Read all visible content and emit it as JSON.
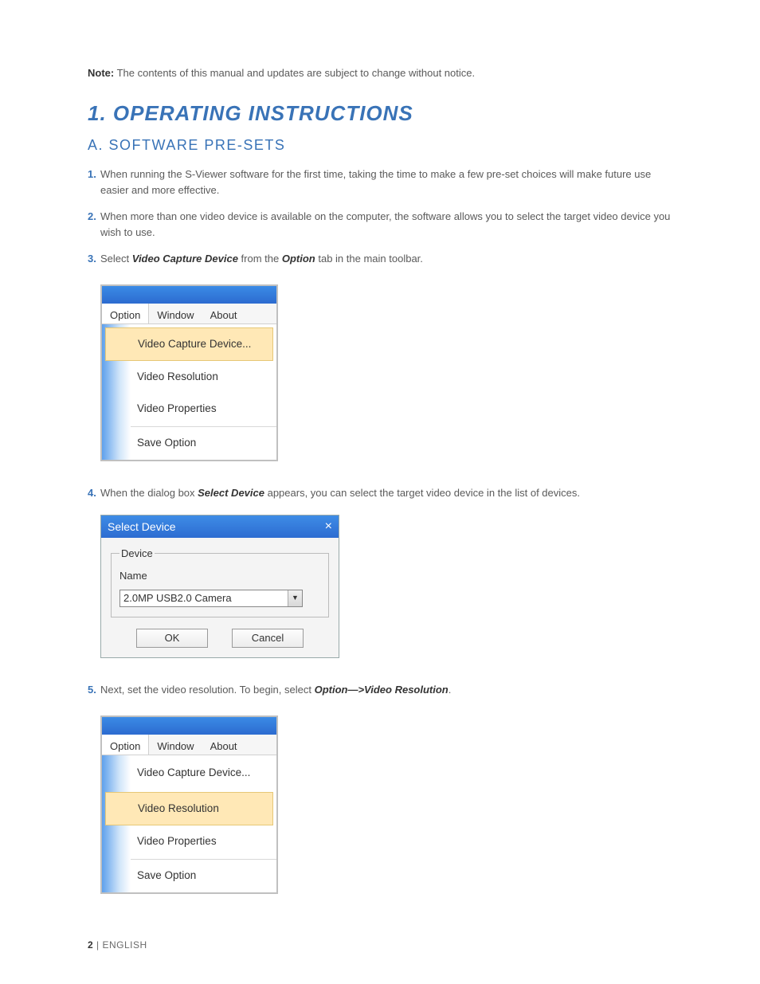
{
  "note": {
    "label": "Note:",
    "text": " The contents of this manual and updates are subject to change without notice."
  },
  "section_title": "1. Operating Instructions",
  "subsection_title": "A. Software Pre-Sets",
  "items": {
    "i1": {
      "num": "1.",
      "text": "When running the S-Viewer software for the first time, taking the time to make a few pre-set choices will make future use easier and more effective."
    },
    "i2": {
      "num": "2.",
      "text": "When more than one video device is available on the computer, the software allows you to select the target video device you wish to use."
    },
    "i3": {
      "num": "3.",
      "pre": "Select ",
      "em1": "Video Capture Device",
      "mid": " from the ",
      "em2": "Option",
      "post": " tab in the main toolbar."
    },
    "i4": {
      "num": "4.",
      "pre": "When the dialog box ",
      "em1": "Select Device",
      "mid": " appears",
      "post": ", you can select the target video device in the list of devices."
    },
    "i5": {
      "num": "5.",
      "pre": "Next, set the video resolution. To begin, select ",
      "em1": "Option—>Video Resolution",
      "post": "."
    }
  },
  "fig1": {
    "menus": {
      "option": "Option",
      "window": "Window",
      "about": "About"
    },
    "dropdown": {
      "capture": "Video Capture Device...",
      "resolution": "Video Resolution",
      "properties": "Video Properties",
      "save": "Save Option"
    }
  },
  "fig2": {
    "title": "Select Device",
    "close": "×",
    "legend": "Device",
    "label": "Name",
    "selected": "2.0MP USB2.0 Camera",
    "ok": "OK",
    "cancel": "Cancel"
  },
  "fig3": {
    "menus": {
      "option": "Option",
      "window": "Window",
      "about": "About"
    },
    "dropdown": {
      "capture": "Video Capture Device...",
      "resolution": "Video Resolution",
      "properties": "Video Properties",
      "save": "Save Option"
    }
  },
  "footer": {
    "pagenum": "2",
    "sep": " | ",
    "lang": "ENGLISH"
  }
}
